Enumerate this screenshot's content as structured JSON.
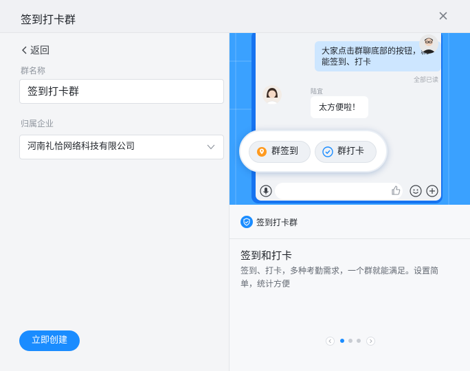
{
  "window": {
    "title": "签到打卡群"
  },
  "form": {
    "back_label": "返回",
    "group_name_label": "群名称",
    "group_name_value": "签到打卡群",
    "org_label": "归属企业",
    "org_value": "河南礼恰网络科技有限公司",
    "create_label": "立即创建"
  },
  "preview": {
    "chat_message": "大家点击群聊底部的按钮，就能签到、打卡",
    "read_status": "全部已读",
    "sender_name": "陆宜",
    "reply_message": "太方便啦！",
    "sign_button": "群签到",
    "punch_button": "群打卡"
  },
  "feature": {
    "tag": "签到打卡群",
    "title": "签到和打卡",
    "description": "签到、打卡，多种考勤需求，一个群就能满足。设置简单，统计方便"
  },
  "pager": {
    "total": 3,
    "active": 1
  },
  "colors": {
    "accent": "#1a8cff",
    "preview_bg": "#3aa1ff",
    "phone": "#1673f0",
    "bubble": "#cde6ff"
  }
}
